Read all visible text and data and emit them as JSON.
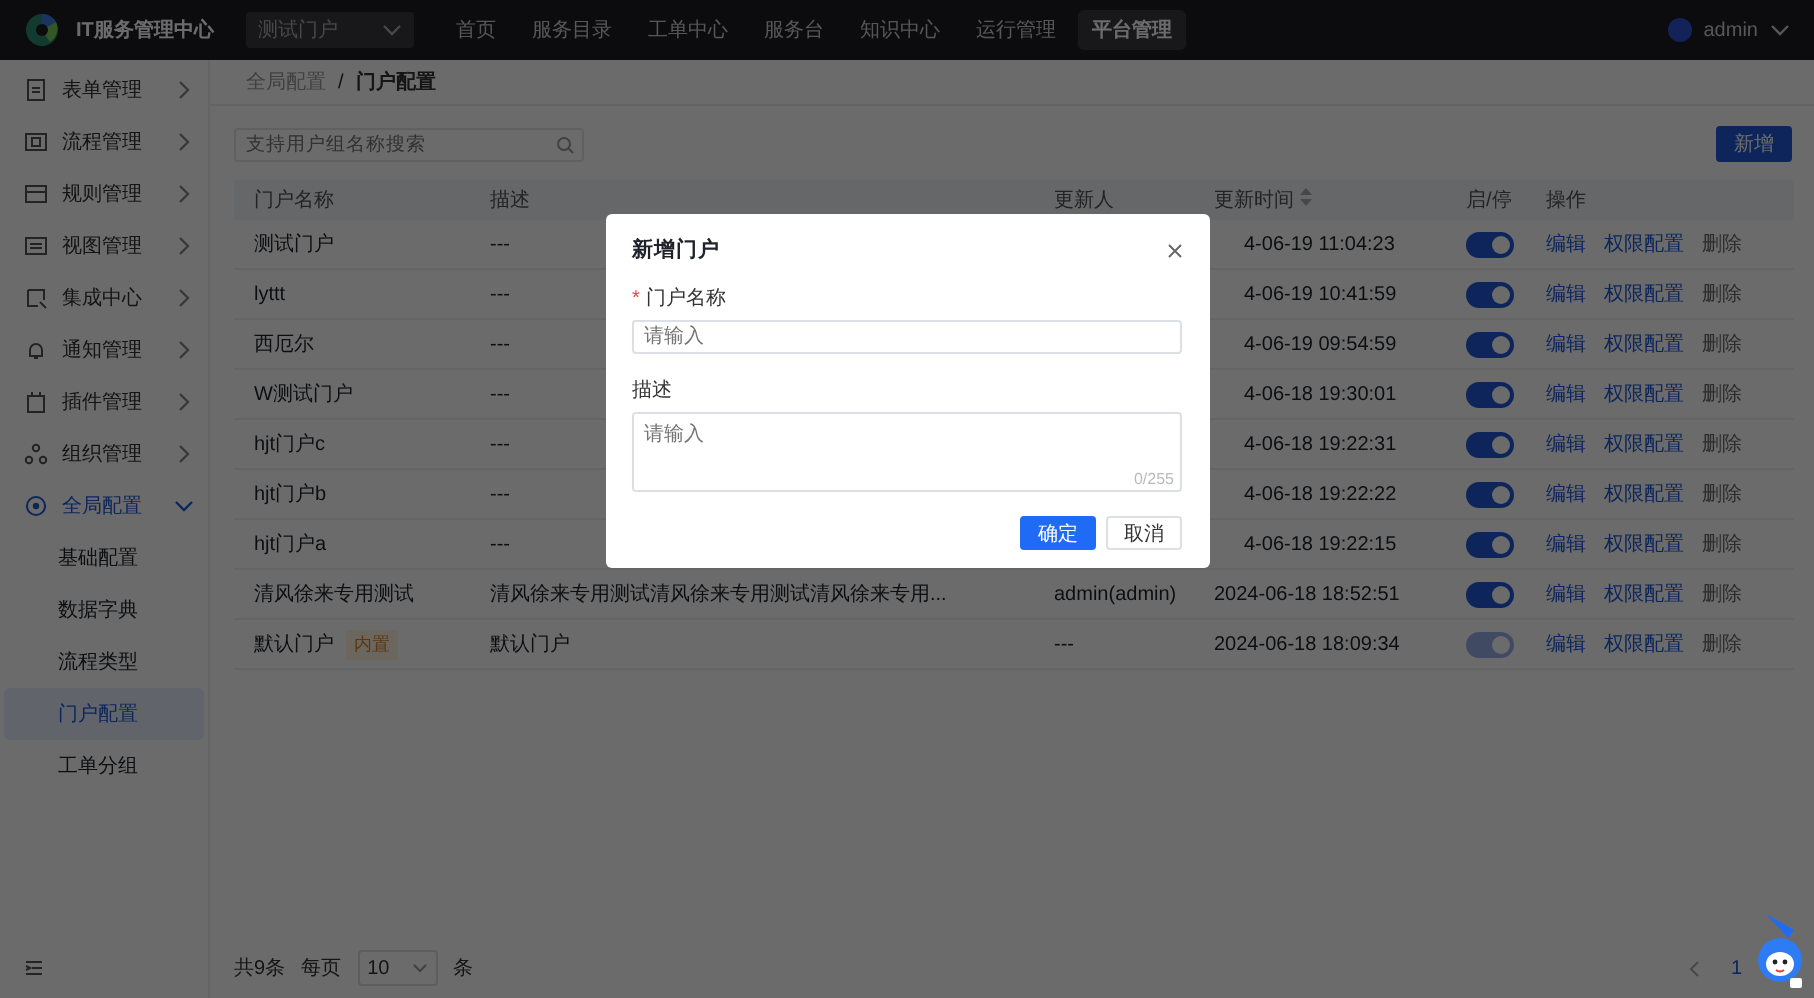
{
  "topbar": {
    "title": "IT服务管理中心",
    "portal_select": {
      "value": "测试门户"
    },
    "nav": [
      {
        "label": "首页",
        "selected": false
      },
      {
        "label": "服务目录",
        "selected": false
      },
      {
        "label": "工单中心",
        "selected": false
      },
      {
        "label": "服务台",
        "selected": false
      },
      {
        "label": "知识中心",
        "selected": false
      },
      {
        "label": "运行管理",
        "selected": false
      },
      {
        "label": "平台管理",
        "selected": true
      }
    ],
    "user": {
      "name": "admin"
    }
  },
  "sidebar": {
    "items": [
      {
        "label": "表单管理",
        "expanded": false,
        "selected": false
      },
      {
        "label": "流程管理",
        "expanded": false,
        "selected": false
      },
      {
        "label": "规则管理",
        "expanded": false,
        "selected": false
      },
      {
        "label": "视图管理",
        "expanded": false,
        "selected": false
      },
      {
        "label": "集成中心",
        "expanded": false,
        "selected": false
      },
      {
        "label": "通知管理",
        "expanded": false,
        "selected": false
      },
      {
        "label": "插件管理",
        "expanded": false,
        "selected": false
      },
      {
        "label": "组织管理",
        "expanded": false,
        "selected": false
      },
      {
        "label": "全局配置",
        "expanded": true,
        "selected": true,
        "children": [
          {
            "label": "基础配置",
            "selected": false
          },
          {
            "label": "数据字典",
            "selected": false
          },
          {
            "label": "流程类型",
            "selected": false
          },
          {
            "label": "门户配置",
            "selected": true
          },
          {
            "label": "工单分组",
            "selected": false
          }
        ]
      }
    ]
  },
  "breadcrumb": {
    "items": [
      "全局配置",
      "门户配置"
    ],
    "separator": "/"
  },
  "search": {
    "placeholder": "支持用户组名称搜索"
  },
  "add_button": "新增",
  "table": {
    "columns": [
      "门户名称",
      "描述",
      "更新人",
      "更新时间",
      "启/停",
      "操作"
    ],
    "rows": [
      {
        "name": "测试门户",
        "description": "---",
        "time": "4-06-19 11:04:23",
        "on": true,
        "disabled": false,
        "actions": [
          {
            "label": "编辑",
            "disabled": false
          },
          {
            "label": "权限配置",
            "disabled": false
          },
          {
            "label": "删除",
            "disabled": true
          }
        ]
      },
      {
        "name": "lyttt",
        "description": "---",
        "time": "4-06-19 10:41:59",
        "on": true,
        "disabled": false,
        "actions": [
          {
            "label": "编辑",
            "disabled": false
          },
          {
            "label": "权限配置",
            "disabled": false
          },
          {
            "label": "删除",
            "disabled": true
          }
        ]
      },
      {
        "name": "西厄尔",
        "description": "---",
        "time": "4-06-19 09:54:59",
        "on": true,
        "disabled": false,
        "actions": [
          {
            "label": "编辑",
            "disabled": false
          },
          {
            "label": "权限配置",
            "disabled": false
          },
          {
            "label": "删除",
            "disabled": true
          }
        ]
      },
      {
        "name": "W测试门户",
        "description": "---",
        "time": "4-06-18 19:30:01",
        "on": true,
        "disabled": false,
        "actions": [
          {
            "label": "编辑",
            "disabled": false
          },
          {
            "label": "权限配置",
            "disabled": false
          },
          {
            "label": "删除",
            "disabled": true
          }
        ]
      },
      {
        "name": "hjt门户c",
        "description": "---",
        "time": "4-06-18 19:22:31",
        "on": true,
        "disabled": false,
        "actions": [
          {
            "label": "编辑",
            "disabled": false
          },
          {
            "label": "权限配置",
            "disabled": false
          },
          {
            "label": "删除",
            "disabled": true
          }
        ]
      },
      {
        "name": "hjt门户b",
        "description": "---",
        "time": "4-06-18 19:22:22",
        "on": true,
        "disabled": false,
        "actions": [
          {
            "label": "编辑",
            "disabled": false
          },
          {
            "label": "权限配置",
            "disabled": false
          },
          {
            "label": "删除",
            "disabled": true
          }
        ]
      },
      {
        "name": "hjt门户a",
        "description": "---",
        "time": "4-06-18 19:22:15",
        "on": true,
        "disabled": false,
        "actions": [
          {
            "label": "编辑",
            "disabled": false
          },
          {
            "label": "权限配置",
            "disabled": false
          },
          {
            "label": "删除",
            "disabled": true
          }
        ]
      },
      {
        "name": "清风徐来专用测试",
        "description": "清风徐来专用测试清风徐来专用测试清风徐来专用...",
        "updater": "admin(admin)",
        "time": "2024-06-18 18:52:51",
        "on": true,
        "disabled": false,
        "actions": [
          {
            "label": "编辑",
            "disabled": false
          },
          {
            "label": "权限配置",
            "disabled": false
          },
          {
            "label": "删除",
            "disabled": true
          }
        ]
      },
      {
        "name": "默认门户",
        "tag": "内置",
        "description": "默认门户",
        "updater": "---",
        "time": "2024-06-18 18:09:34",
        "on": true,
        "disabled": true,
        "actions": [
          {
            "label": "编辑",
            "disabled": false
          },
          {
            "label": "权限配置",
            "disabled": false
          },
          {
            "label": "删除",
            "disabled": true
          }
        ]
      }
    ]
  },
  "pagination": {
    "total": "共9条",
    "per_page_label": "每页",
    "page_size": "10",
    "unit": "条",
    "pages": [
      {
        "label": "1",
        "selected": true
      }
    ]
  },
  "modal": {
    "title": "新增门户",
    "fields": [
      {
        "kind": "input",
        "label": "门户名称",
        "required_mark": "*",
        "placeholder": "请输入"
      },
      {
        "kind": "textarea",
        "label": "描述",
        "placeholder": "请输入",
        "count": "0/255"
      }
    ],
    "buttons": [
      {
        "label": "确定",
        "kind": "primary"
      },
      {
        "label": "取消",
        "kind": "default"
      }
    ]
  }
}
